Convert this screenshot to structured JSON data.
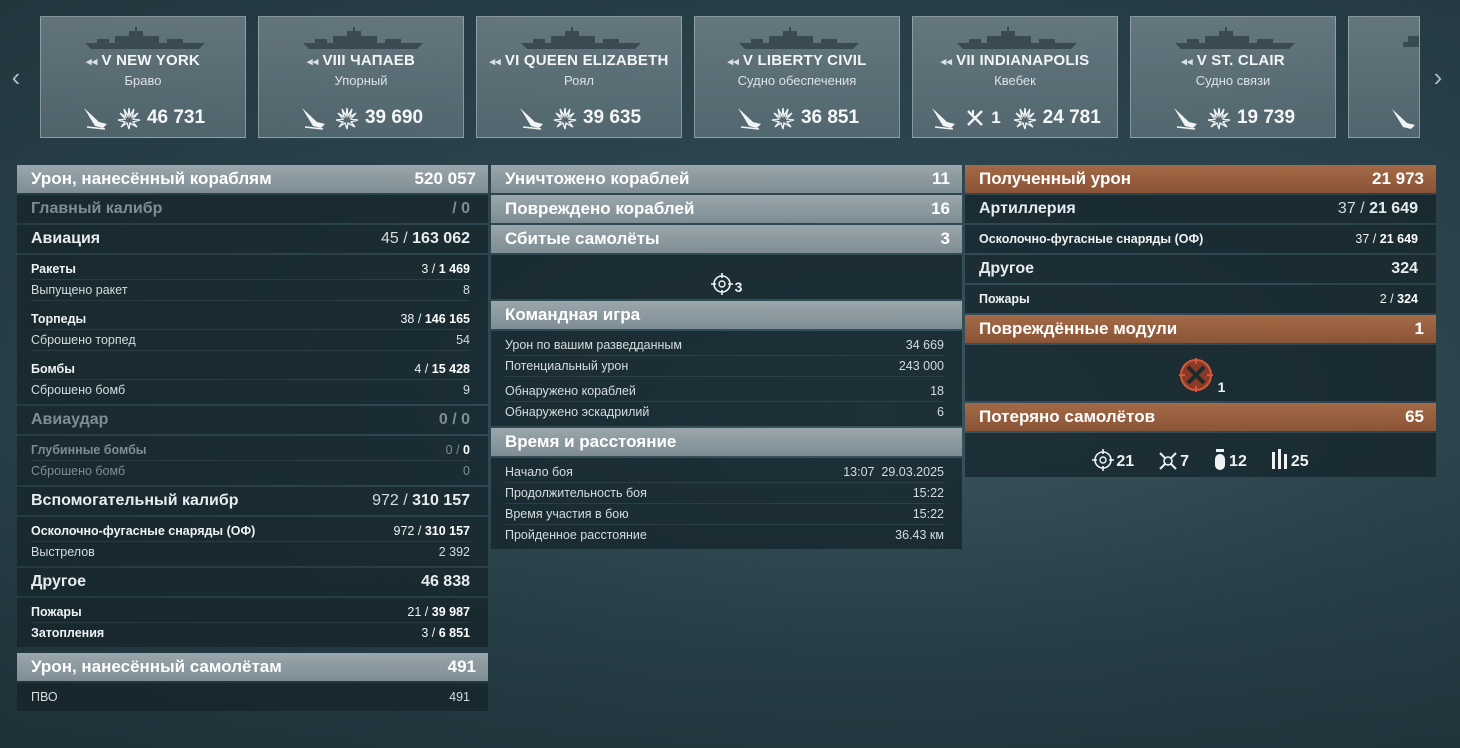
{
  "carousel": {
    "cards": [
      {
        "tier": "V",
        "name": "NEW YORK",
        "sub": "Браво",
        "stats": [
          {
            "icon": "damage",
            "value": "46 731"
          }
        ]
      },
      {
        "tier": "VIII",
        "name": "ЧАПАЕВ",
        "sub": "Упорный",
        "stats": [
          {
            "icon": "damage",
            "value": "39 690"
          }
        ]
      },
      {
        "tier": "VI",
        "name": "QUEEN ELIZABETH",
        "sub": "Роял",
        "stats": [
          {
            "icon": "damage",
            "value": "39 635"
          }
        ]
      },
      {
        "tier": "V",
        "name": "LIBERTY CIVIL",
        "sub": "Судно обеспечения",
        "stats": [
          {
            "icon": "damage",
            "value": "36 851"
          }
        ]
      },
      {
        "tier": "VII",
        "name": "INDIANAPOLIS",
        "sub": "Квебек",
        "kills": "1",
        "stats": [
          {
            "icon": "damage",
            "value": "24 781"
          }
        ]
      },
      {
        "tier": "V",
        "name": "ST. CLAIR",
        "sub": "Судно связи",
        "stats": [
          {
            "icon": "damage",
            "value": "19 739"
          }
        ]
      }
    ]
  },
  "left": {
    "main": {
      "label": "Урон, нанесённый кораблям",
      "value": "520 057"
    },
    "main_caliber": {
      "label": "Главный калибр",
      "value": "/ 0"
    },
    "aviation": {
      "label": "Авиация",
      "value_a": "45 /",
      "value_b": "163 062"
    },
    "rockets": {
      "label": "Ракеты",
      "a": "3 /",
      "b": "1 469"
    },
    "rockets_fired": {
      "label": "Выпущено ракет",
      "value": "8"
    },
    "torpedoes": {
      "label": "Торпеды",
      "a": "38 /",
      "b": "146 165"
    },
    "torpedoes_dropped": {
      "label": "Сброшено торпед",
      "value": "54"
    },
    "bombs": {
      "label": "Бомбы",
      "a": "4 /",
      "b": "15 428"
    },
    "bombs_dropped": {
      "label": "Сброшено бомб",
      "value": "9"
    },
    "airstrike": {
      "label": "Авиаудар",
      "value": "0 / 0"
    },
    "depth": {
      "label": "Глубинные бомбы",
      "a": "0 /",
      "b": "0"
    },
    "depth_dropped": {
      "label": "Сброшено бомб",
      "value": "0"
    },
    "secondary": {
      "label": "Вспомогательный калибр",
      "value_a": "972 /",
      "value_b": "310 157"
    },
    "he": {
      "label": "Осколочно-фугасные снаряды (ОФ)",
      "a": "972 /",
      "b": "310 157"
    },
    "shots": {
      "label": "Выстрелов",
      "value": "2 392"
    },
    "other": {
      "label": "Другое",
      "value": "46 838"
    },
    "fires": {
      "label": "Пожары",
      "a": "21 /",
      "b": "39 987"
    },
    "floods": {
      "label": "Затопления",
      "a": "3 /",
      "b": "6 851"
    },
    "planes": {
      "label": "Урон, нанесённый самолётам",
      "value": "491"
    },
    "aa": {
      "label": "ПВО",
      "value": "491"
    }
  },
  "middle": {
    "destroyed": {
      "label": "Уничтожено кораблей",
      "value": "11"
    },
    "damaged": {
      "label": "Повреждено кораблей",
      "value": "16"
    },
    "shot_down": {
      "label": "Сбитые самолёты",
      "value": "3"
    },
    "shot_down_icon_count": "3",
    "team": {
      "label": "Командная игра"
    },
    "spot_damage": {
      "label": "Урон по вашим разведданным",
      "value": "34 669"
    },
    "potential": {
      "label": "Потенциальный урон",
      "value": "243 000"
    },
    "spotted_ships": {
      "label": "Обнаружено кораблей",
      "value": "18"
    },
    "spotted_squads": {
      "label": "Обнаружено эскадрилий",
      "value": "6"
    },
    "time": {
      "label": "Время и расстояние"
    },
    "start": {
      "label": "Начало боя",
      "value": "13:07  29.03.2025"
    },
    "duration": {
      "label": "Продолжительность боя",
      "value": "15:22"
    },
    "participation": {
      "label": "Время участия в бою",
      "value": "15:22"
    },
    "distance": {
      "label": "Пройденное расстояние",
      "value": "36.43 км"
    }
  },
  "right": {
    "received": {
      "label": "Полученный урон",
      "value": "21 973"
    },
    "artillery": {
      "label": "Артиллерия",
      "value_a": "37 /",
      "value_b": "21 649"
    },
    "he": {
      "label": "Осколочно-фугасные снаряды (ОФ)",
      "a": "37 /",
      "b": "21 649"
    },
    "other": {
      "label": "Другое",
      "value": "324"
    },
    "fires": {
      "label": "Пожары",
      "a": "2 /",
      "b": "324"
    },
    "modules": {
      "label": "Повреждённые модули",
      "value": "1"
    },
    "modules_icon_count": "1",
    "lost_planes": {
      "label": "Потеряно самолётов",
      "value": "65"
    },
    "lost": [
      {
        "icon": "crosshair",
        "value": "21"
      },
      {
        "icon": "fighter",
        "value": "7"
      },
      {
        "icon": "bomb",
        "value": "12"
      },
      {
        "icon": "rockets",
        "value": "25"
      }
    ]
  },
  "colors": {
    "header_grey": "#8b989e",
    "header_orange": "#975e3e",
    "panel": "#14222880"
  }
}
